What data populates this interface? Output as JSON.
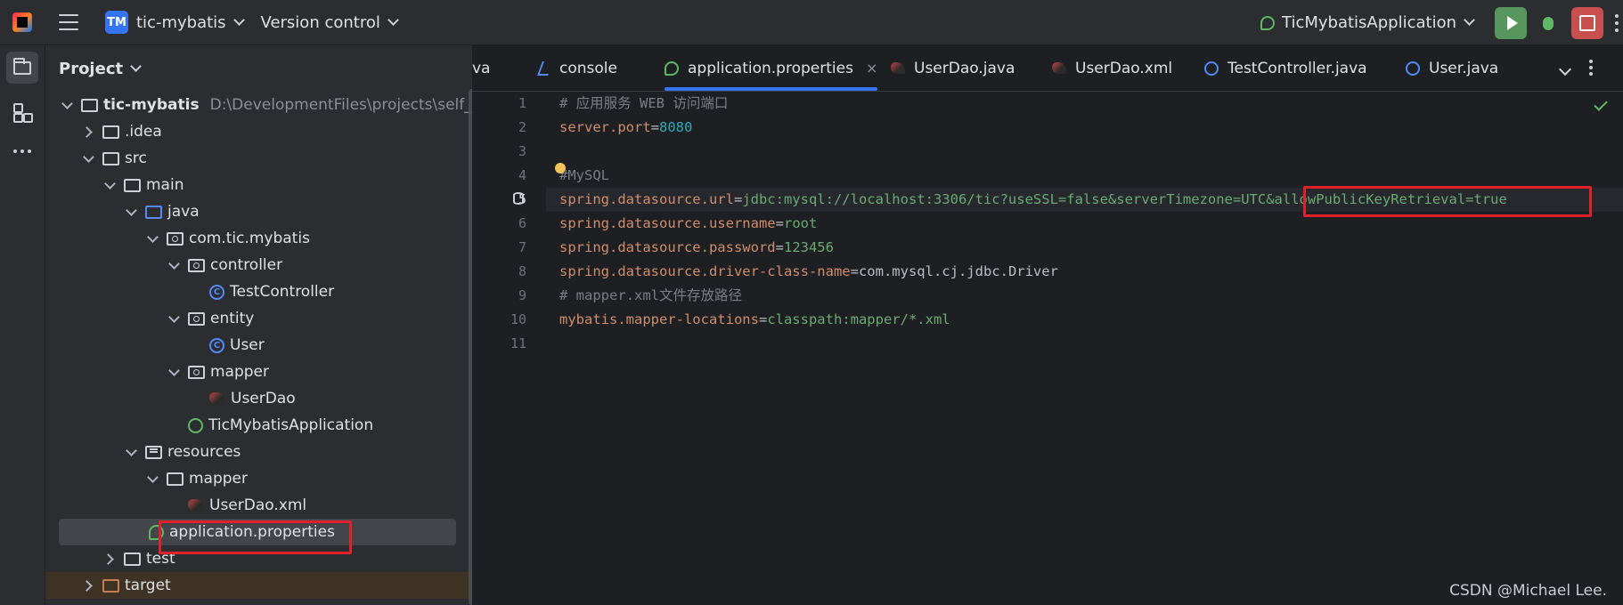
{
  "titlebar": {
    "project_badge": "TM",
    "project_name": "tic-mybatis",
    "version_control": "Version control",
    "run_config": "TicMybatisApplication"
  },
  "project_panel": {
    "title": "Project",
    "tree": [
      {
        "label": "tic-mybatis",
        "path": "D:\\DevelopmentFiles\\projects\\self_proje"
      },
      {
        "label": ".idea"
      },
      {
        "label": "src"
      },
      {
        "label": "main"
      },
      {
        "label": "java"
      },
      {
        "label": "com.tic.mybatis"
      },
      {
        "label": "controller"
      },
      {
        "label": "TestController"
      },
      {
        "label": "entity"
      },
      {
        "label": "User"
      },
      {
        "label": "mapper"
      },
      {
        "label": "UserDao"
      },
      {
        "label": "TicMybatisApplication"
      },
      {
        "label": "resources"
      },
      {
        "label": "mapper"
      },
      {
        "label": "UserDao.xml"
      },
      {
        "label": "application.properties"
      },
      {
        "label": "test"
      },
      {
        "label": "target"
      }
    ]
  },
  "editor": {
    "tabs": [
      {
        "label": "va"
      },
      {
        "label": "console"
      },
      {
        "label": "application.properties"
      },
      {
        "label": "UserDao.java"
      },
      {
        "label": "UserDao.xml"
      },
      {
        "label": "TestController.java"
      },
      {
        "label": "User.java"
      }
    ],
    "tab_close": "×",
    "lines": [
      {
        "n": "1",
        "comment": "# 应用服务 WEB 访问端口"
      },
      {
        "n": "2",
        "key": "server.port",
        "eq": "=",
        "num": "8080"
      },
      {
        "n": "3"
      },
      {
        "n": "4",
        "comment": "#MySQL"
      },
      {
        "n": "5",
        "key": "spring.datasource.url",
        "eq": "=",
        "val": "jdbc:mysql://localhost:3306/tic?useSSL=false&serverTimezone=UTC&allowPublicKeyRetrieval=true"
      },
      {
        "n": "6",
        "key": "spring.datasource.username",
        "eq": "=",
        "val": "root"
      },
      {
        "n": "7",
        "key": "spring.datasource.password",
        "eq": "=",
        "val": "123456"
      },
      {
        "n": "8",
        "key": "spring.datasource.driver-class-name",
        "eq": "=",
        "plain": "com.mysql.cj.jdbc.Driver"
      },
      {
        "n": "9",
        "comment": "# mapper.xml文件存放路径"
      },
      {
        "n": "10",
        "key": "mybatis.mapper-locations",
        "eq": "=",
        "val": "classpath:mapper/*.xml"
      },
      {
        "n": "11"
      }
    ]
  },
  "watermark": "CSDN @Michael Lee.",
  "colors": {
    "accent": "#3574f0",
    "highlight_box": "#e0202a",
    "run_button": "#57965c",
    "stop_button": "#c94f4f"
  }
}
